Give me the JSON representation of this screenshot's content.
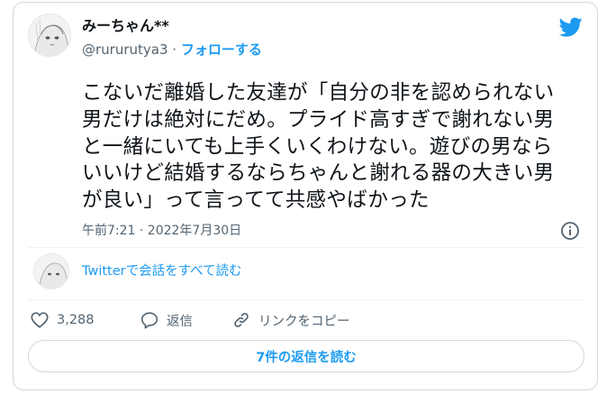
{
  "tweet": {
    "display_name": "みーちゃん**",
    "handle": "@rururutya3",
    "separator": "·",
    "follow_label": "フォローする",
    "text_lines": [
      "こないだ離婚した友達が「自分の非を認められない",
      "男だけは絶対にだめ。プライド高すぎで謝れない男",
      "と一緒にいても上手くいくわけない。遊びの男なら",
      "いいけど結婚するならちゃんと謝れる器の大きい男",
      "が良い」って言ってて共感やばかった"
    ],
    "timestamp": "午前7:21 · 2022年7月30日"
  },
  "thread": {
    "read_all_label": "Twitterで会話をすべて読む"
  },
  "actions": {
    "like_count": "3,288",
    "reply_label": "返信",
    "copy_link_label": "リンクをコピー"
  },
  "read_replies_label": "7件の返信を読む",
  "colors": {
    "accent": "#1d9bf0",
    "secondary_text": "#536471",
    "border": "#cfd9de"
  },
  "icons": [
    "twitter-bird-icon",
    "info-icon",
    "heart-icon",
    "reply-icon",
    "link-icon"
  ]
}
